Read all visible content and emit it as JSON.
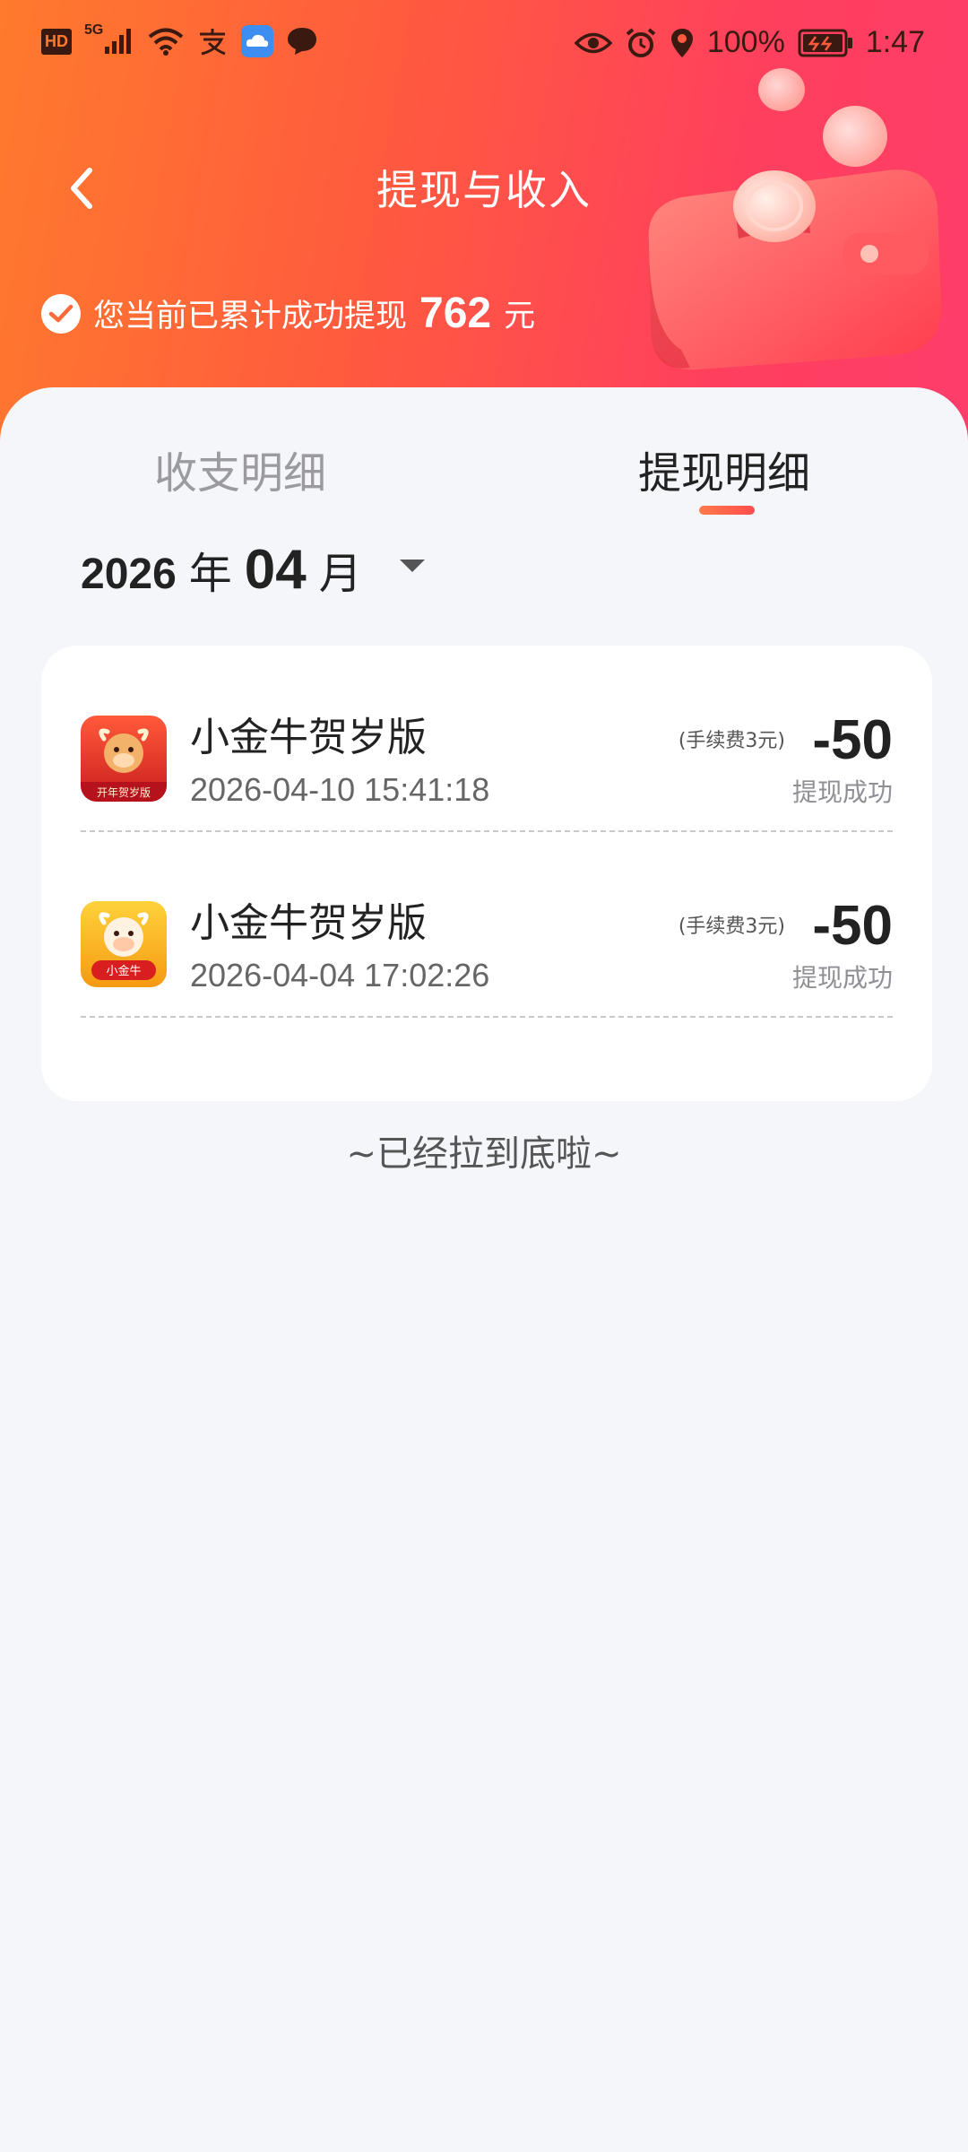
{
  "status_bar": {
    "hd": "HD",
    "network": "5G",
    "battery": "100%",
    "time": "1:47"
  },
  "nav": {
    "title": "提现与收入"
  },
  "summary": {
    "prefix": "您当前已累计成功提现",
    "amount": "762",
    "unit": "元"
  },
  "tabs": [
    {
      "label": "收支明细",
      "active": false
    },
    {
      "label": "提现明细",
      "active": true
    }
  ],
  "month_selector": {
    "year": "2026",
    "year_unit": "年",
    "month": "04",
    "month_unit": "月"
  },
  "records": [
    {
      "title": "小金牛贺岁版",
      "time": "2026-04-10 15:41:18",
      "fee": "(手续费3元)",
      "amount": "-50",
      "status": "提现成功",
      "icon_caption": "开年贺岁版"
    },
    {
      "title": "小金牛贺岁版",
      "time": "2026-04-04 17:02:26",
      "fee": "(手续费3元)",
      "amount": "-50",
      "status": "提现成功",
      "icon_caption": "小金牛"
    }
  ],
  "footer": {
    "end_text": "~已经拉到底啦~"
  },
  "colors": {
    "header_start": "#ff7a2c",
    "header_end": "#ff3d6b",
    "background": "#f5f6fa",
    "accent": "#ff4d4d"
  }
}
